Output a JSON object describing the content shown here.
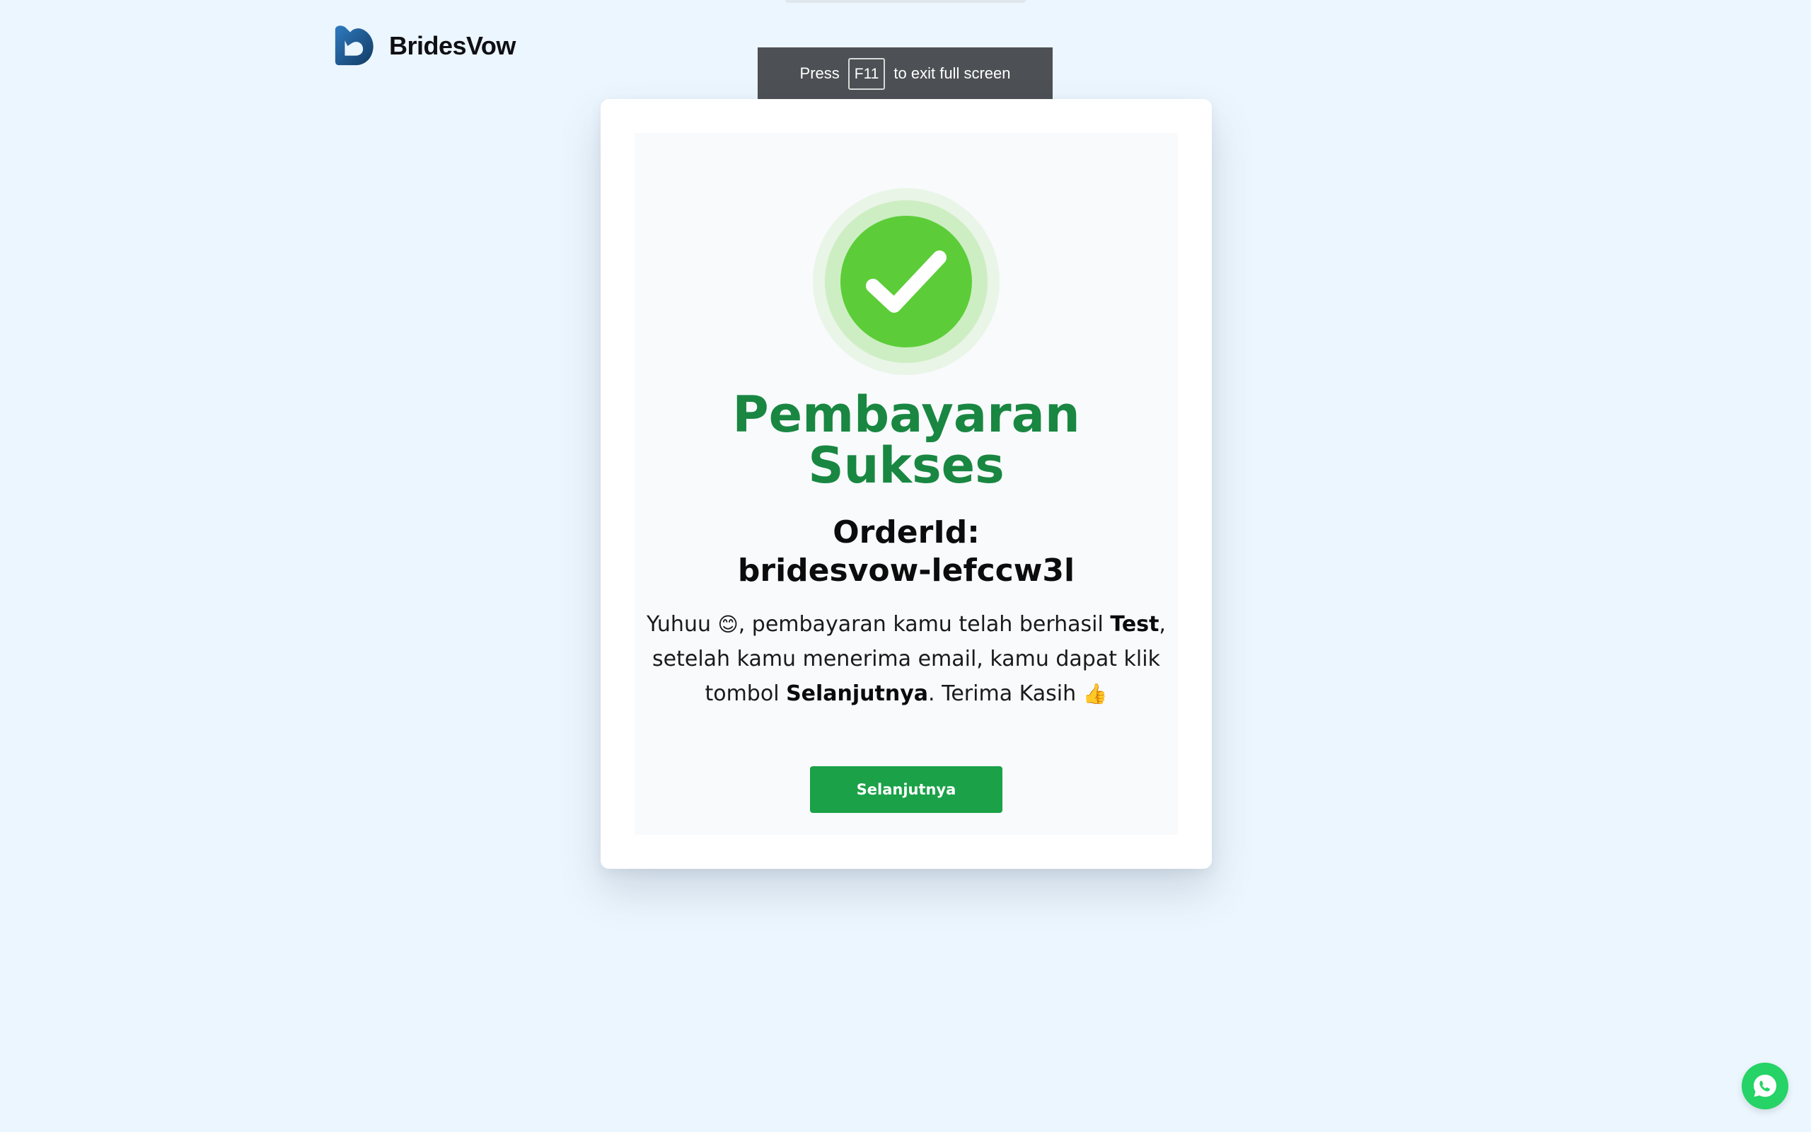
{
  "brand": {
    "name": "BridesVow",
    "logo_icon": "heart-logo-icon",
    "logo_color": "#1f5a8c"
  },
  "fullscreen_notice": {
    "prefix": "Press",
    "key": "F11",
    "suffix": "to exit full screen"
  },
  "payment": {
    "status_icon": "check-circle-icon",
    "title": "Pembayaran Sukses",
    "order_label": "OrderId:",
    "order_id": "bridesvow-lefccw3l",
    "message": {
      "part1": "Yuhuu ",
      "emoji1": "😊",
      "part2": ", pembayaran kamu telah berhasil ",
      "bold1": "Test",
      "part3": ", setelah kamu menerima email, kamu dapat klik tombol ",
      "bold2": "Selanjutnya",
      "part4": ". Terima Kasih ",
      "emoji2": "👍"
    },
    "next_button_label": "Selanjutnya"
  },
  "whatsapp": {
    "icon": "whatsapp-icon",
    "color": "#25d366"
  },
  "colors": {
    "background": "#ecf6fe",
    "success_green": "#5ccd38",
    "title_green": "#198741",
    "button_green": "#1ba148"
  }
}
